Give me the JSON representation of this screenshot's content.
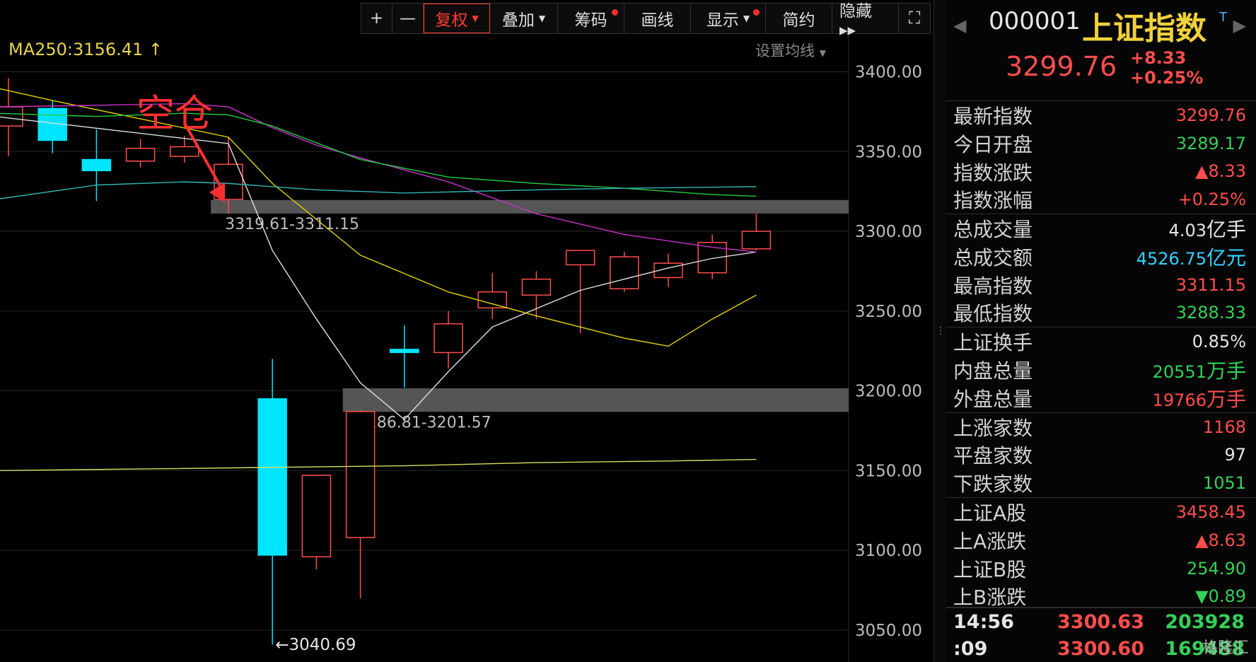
{
  "toolbar": {
    "plus": "+",
    "minus": "—",
    "fuquan": "复权",
    "diejia": "叠加",
    "chouma": "筹码",
    "huaxian": "画线",
    "xianshi": "显示",
    "jianyue": "简约",
    "yincang": "隐藏 ▸▸",
    "fullscreen": "⛶"
  },
  "ma_label": "MA250:3156.41 ↑",
  "ma_settings": "设置均线",
  "annotation": "空仓",
  "colors": {
    "up": "#ff4d4d",
    "down": "#00e5ff",
    "ma5": "#e0e0e0",
    "ma10": "#e2d400",
    "ma20": "#cc33cc",
    "ma60": "#22cc44",
    "ma120": "#33b5b5",
    "ma250": "#d9e060",
    "band": "#555555",
    "accent": "#ff3b30"
  },
  "chart_data": {
    "type": "candlestick",
    "ylim": [
      3030,
      3445
    ],
    "y_ticks": [
      "3400.00",
      "3350.00",
      "3300.00",
      "3250.00",
      "3200.00",
      "3150.00",
      "3100.00",
      "3050.00"
    ],
    "candles": [
      {
        "o": 3366,
        "h": 3396,
        "l": 3347,
        "c": 3378
      },
      {
        "o": 3377,
        "h": 3382,
        "l": 3349,
        "c": 3357
      },
      {
        "o": 3345,
        "h": 3364,
        "l": 3319,
        "c": 3338
      },
      {
        "o": 3344,
        "h": 3358,
        "l": 3340,
        "c": 3352
      },
      {
        "o": 3347,
        "h": 3360,
        "l": 3343,
        "c": 3353
      },
      {
        "o": 3320,
        "h": 3359,
        "l": 3311,
        "c": 3342
      },
      {
        "o": 3195,
        "h": 3220,
        "l": 3041,
        "c": 3097
      },
      {
        "o": 3096,
        "h": 3147,
        "l": 3088,
        "c": 3147
      },
      {
        "o": 3108,
        "h": 3188,
        "l": 3070,
        "c": 3187
      },
      {
        "o": 3226,
        "h": 3241,
        "l": 3202,
        "c": 3224
      },
      {
        "o": 3224,
        "h": 3250,
        "l": 3214,
        "c": 3242
      },
      {
        "o": 3252,
        "h": 3274,
        "l": 3245,
        "c": 3262
      },
      {
        "o": 3260,
        "h": 3275,
        "l": 3245,
        "c": 3270
      },
      {
        "o": 3279,
        "h": 3282,
        "l": 3236,
        "c": 3288
      },
      {
        "o": 3264,
        "h": 3287,
        "l": 3262,
        "c": 3284
      },
      {
        "o": 3271,
        "h": 3286,
        "l": 3265,
        "c": 3280
      },
      {
        "o": 3274,
        "h": 3298,
        "l": 3270,
        "c": 3293
      },
      {
        "o": 3289,
        "h": 3311,
        "l": 3288,
        "c": 3300
      }
    ],
    "ma_lines": [
      {
        "name": "MA5",
        "color": "#e0e0e0",
        "values": [
          [
            -0.3,
            3372
          ],
          [
            5,
            3355
          ],
          [
            6,
            3288
          ],
          [
            7,
            3245
          ],
          [
            8,
            3205
          ],
          [
            9,
            3182
          ],
          [
            10,
            3212
          ],
          [
            11,
            3240
          ],
          [
            13,
            3263
          ],
          [
            15,
            3277
          ],
          [
            16,
            3283
          ],
          [
            17,
            3287
          ]
        ]
      },
      {
        "name": "MA10",
        "color": "#e2d400",
        "values": [
          [
            -0.3,
            3390
          ],
          [
            1,
            3382
          ],
          [
            5,
            3359
          ],
          [
            6,
            3330
          ],
          [
            8,
            3285
          ],
          [
            10,
            3262
          ],
          [
            12,
            3247
          ],
          [
            14,
            3233
          ],
          [
            15,
            3228
          ],
          [
            16,
            3245
          ],
          [
            17,
            3260
          ]
        ]
      },
      {
        "name": "MA20",
        "color": "#cc33cc",
        "values": [
          [
            -0.3,
            3378
          ],
          [
            2,
            3379
          ],
          [
            4,
            3380
          ],
          [
            5,
            3378
          ],
          [
            6,
            3365
          ],
          [
            7,
            3354
          ],
          [
            8,
            3346
          ],
          [
            10,
            3331
          ],
          [
            12,
            3311
          ],
          [
            14,
            3298
          ],
          [
            16,
            3290
          ],
          [
            17,
            3287
          ]
        ]
      },
      {
        "name": "MA60",
        "color": "#22cc44",
        "values": [
          [
            -0.3,
            3374
          ],
          [
            2,
            3372
          ],
          [
            4,
            3374
          ],
          [
            5,
            3373
          ],
          [
            6,
            3366
          ],
          [
            8,
            3345
          ],
          [
            10,
            3334
          ],
          [
            12,
            3330
          ],
          [
            14,
            3327
          ],
          [
            16,
            3323
          ],
          [
            17,
            3322
          ]
        ]
      },
      {
        "name": "MA120",
        "color": "#33b5b5",
        "values": [
          [
            -0.3,
            3320
          ],
          [
            2,
            3329
          ],
          [
            4,
            3331
          ],
          [
            5,
            3330
          ],
          [
            7,
            3326
          ],
          [
            9,
            3324
          ],
          [
            12,
            3326
          ],
          [
            14,
            3327
          ],
          [
            17,
            3328
          ]
        ]
      },
      {
        "name": "MA250",
        "color": "#d9e060",
        "values": [
          [
            -0.3,
            3150
          ],
          [
            3,
            3151
          ],
          [
            6,
            3152
          ],
          [
            9,
            3153
          ],
          [
            12,
            3155
          ],
          [
            15,
            3156
          ],
          [
            17,
            3157
          ]
        ]
      }
    ],
    "bands": [
      {
        "label": "3319.61-3311.15",
        "low": 3311.15,
        "high": 3319.61,
        "start": 4.6
      },
      {
        "label": "3186.81-3201.57",
        "low": 3186.81,
        "high": 3201.57,
        "start": 7.6
      }
    ],
    "low_marker": "←3040.69"
  },
  "panel": {
    "code": "000001",
    "name": "上证指数",
    "badge": "T",
    "price": "3299.76",
    "change": "+8.33",
    "change_pct": "+0.25%",
    "rows": [
      {
        "label": "最新指数",
        "value": "3299.76",
        "color": "red"
      },
      {
        "label": "今日开盘",
        "value": "3289.17",
        "color": "green"
      },
      {
        "label": "指数涨跌",
        "value": "▲8.33",
        "color": "red"
      },
      {
        "label": "指数涨幅",
        "value": "+0.25%",
        "color": "red"
      },
      {
        "label": "总成交量",
        "value": "4.03",
        "unit": "亿手",
        "color": "white"
      },
      {
        "label": "总成交额",
        "value": "4526.75",
        "unit": "亿元",
        "color": "cyan"
      },
      {
        "label": "最高指数",
        "value": "3311.15",
        "color": "red"
      },
      {
        "label": "最低指数",
        "value": "3288.33",
        "color": "green"
      },
      {
        "label": "上证换手",
        "value": "0.85%",
        "color": "white"
      },
      {
        "label": "内盘总量",
        "value": "20551",
        "unit": "万手",
        "color": "green"
      },
      {
        "label": "外盘总量",
        "value": "19766",
        "unit": "万手",
        "color": "red"
      },
      {
        "label": "上涨家数",
        "value": "1168",
        "color": "red"
      },
      {
        "label": "平盘家数",
        "value": "97",
        "color": "white"
      },
      {
        "label": "下跌家数",
        "value": "1051",
        "color": "green"
      },
      {
        "label": "上证A股",
        "value": "3458.45",
        "color": "red"
      },
      {
        "label": "上A涨跌",
        "value": "▲8.63",
        "color": "red"
      },
      {
        "label": "上证B股",
        "value": "254.90",
        "color": "green"
      },
      {
        "label": "上B涨跌",
        "value": "▼0.89",
        "color": "green"
      }
    ],
    "ticks": [
      {
        "time": "14:56",
        "price": "3300.63",
        "vol": "203928"
      },
      {
        "time": ":09",
        "price": "3300.60",
        "vol": "169488"
      }
    ],
    "watermark": "格隆汇"
  }
}
